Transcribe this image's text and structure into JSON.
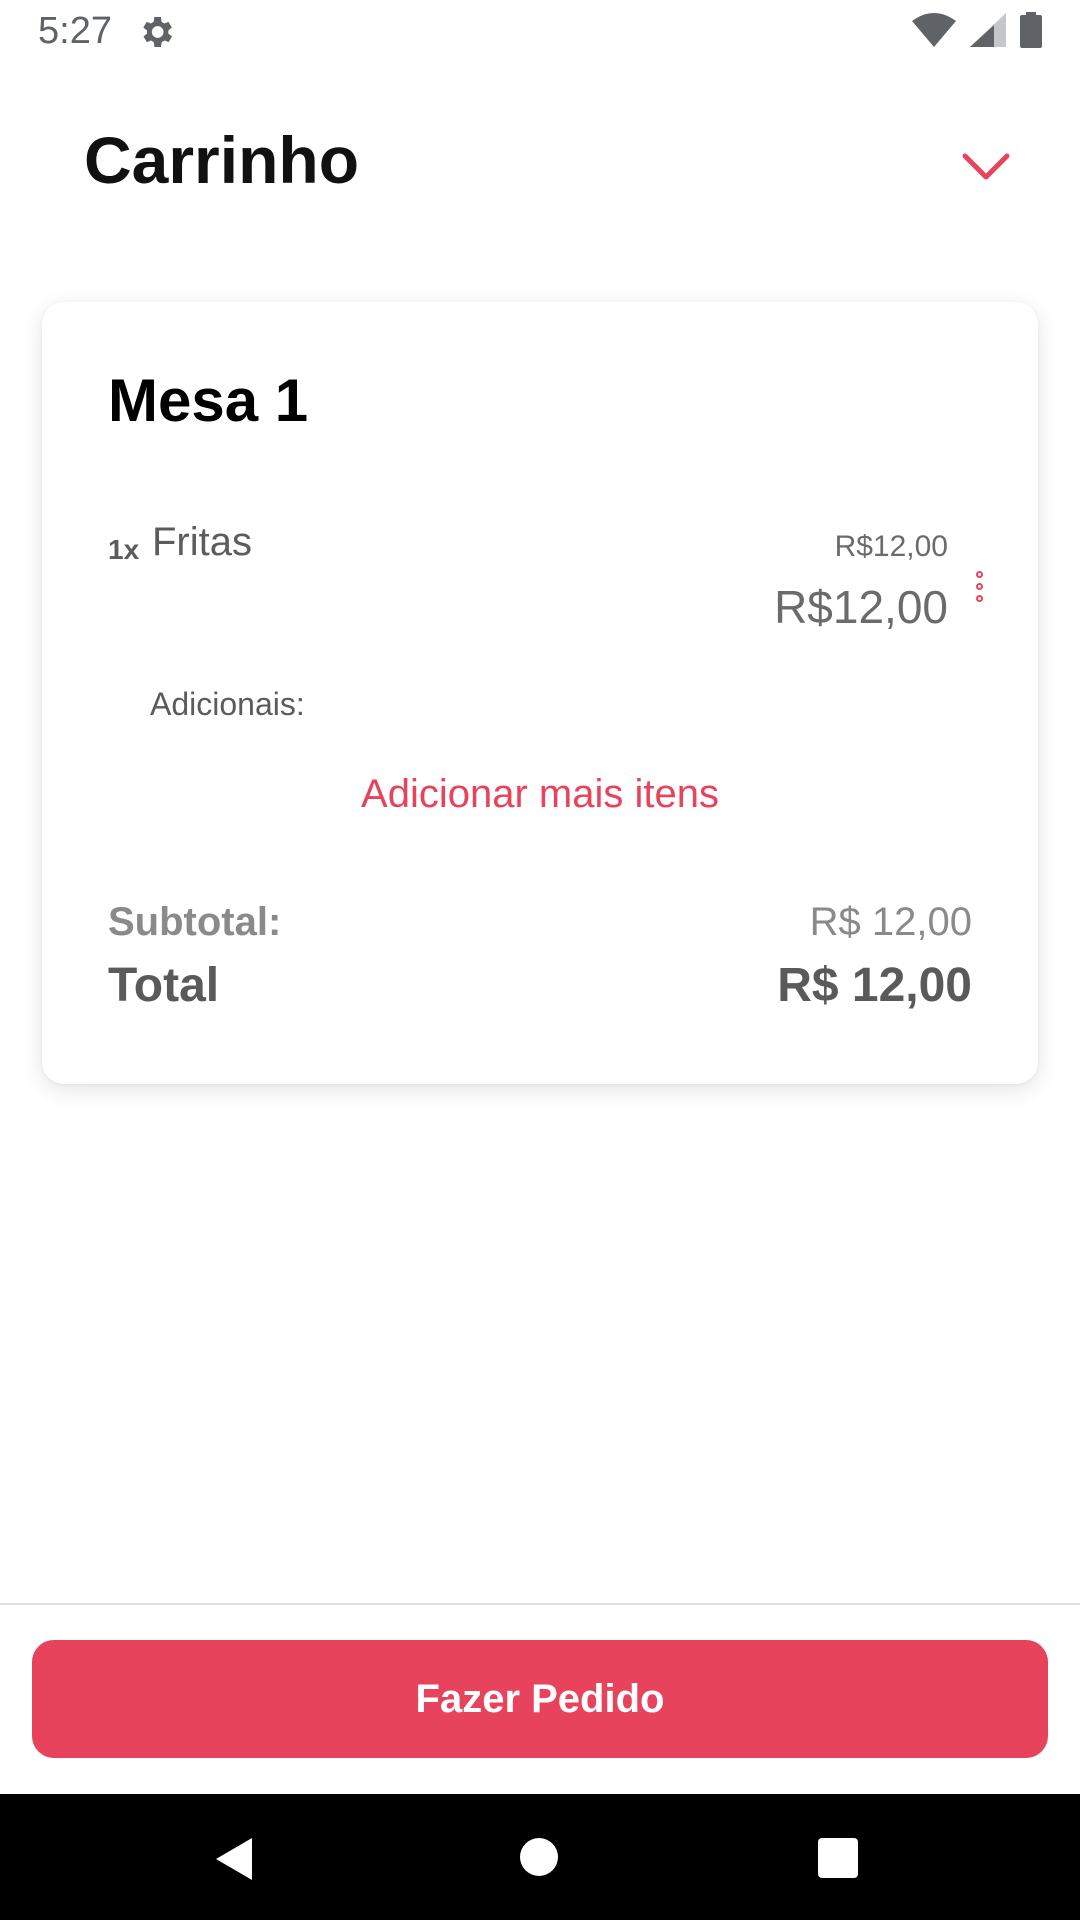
{
  "status_bar": {
    "time": "5:27",
    "icons": [
      "gear-icon",
      "wifi-icon",
      "signal-icon",
      "battery-icon"
    ]
  },
  "header": {
    "title": "Carrinho",
    "collapse_icon": "chevron-down-icon"
  },
  "cart": {
    "table_name": "Mesa 1",
    "items": [
      {
        "quantity": "1x",
        "name": "Fritas",
        "unit_price": "R$12,00",
        "total_price": "R$12,00",
        "menu_icon": "more-vertical-icon"
      }
    ],
    "addons_label": "Adicionais:",
    "add_more_label": "Adicionar mais itens",
    "subtotal_label": "Subtotal:",
    "subtotal_value": "R$ 12,00",
    "total_label": "Total",
    "total_value": "R$ 12,00"
  },
  "footer": {
    "order_button_label": "Fazer Pedido"
  },
  "colors": {
    "accent": "#e8435d",
    "text_muted": "#8a8a8a",
    "text_dark": "#5a5a5a"
  },
  "nav_bar": {
    "icons": [
      "back-icon",
      "home-icon",
      "recent-apps-icon"
    ]
  }
}
